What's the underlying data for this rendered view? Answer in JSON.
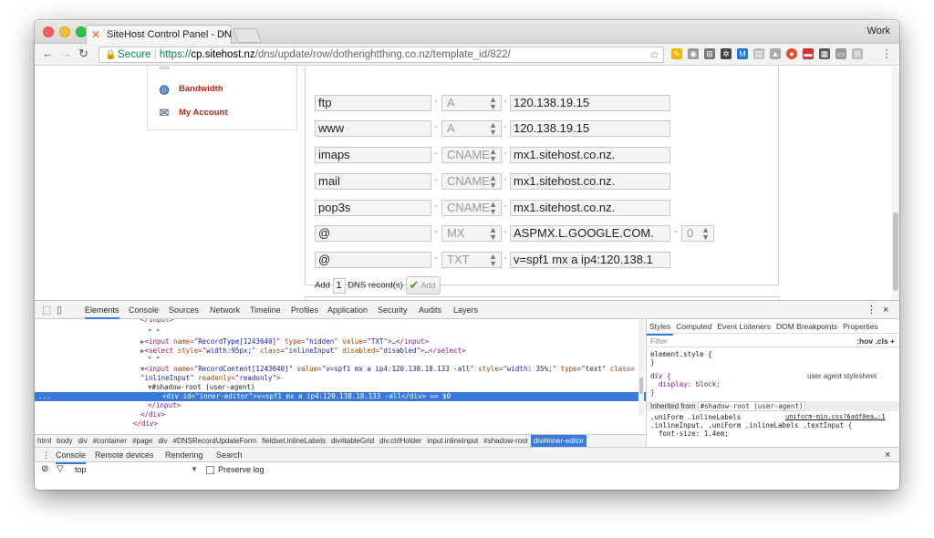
{
  "browser": {
    "tab_title": "SiteHost Control Panel - DNS",
    "tab_close": "×",
    "profile": "Work",
    "url_secure": "Secure",
    "url_scheme": "https://",
    "url_domain": "cp.sitehost.nz",
    "url_path": "/dns/update/row/dotherightthing.co.nz/template_id/822/"
  },
  "sidebar": {
    "items": [
      {
        "label": "Bandwidth",
        "icon": "globe-icon"
      },
      {
        "label": "My Account",
        "icon": "account-icon"
      }
    ]
  },
  "dns": {
    "records": [
      {
        "name": "ftp",
        "type": "A",
        "content": "120.138.19.15",
        "disabled": false
      },
      {
        "name": "www",
        "type": "A",
        "content": "120.138.19.15",
        "disabled": false
      },
      {
        "name": "imaps",
        "type": "CNAME",
        "content": "mx1.sitehost.co.nz.",
        "disabled": true
      },
      {
        "name": "mail",
        "type": "CNAME",
        "content": "mx1.sitehost.co.nz.",
        "disabled": true
      },
      {
        "name": "pop3s",
        "type": "CNAME",
        "content": "mx1.sitehost.co.nz.",
        "disabled": true
      },
      {
        "name": "@",
        "type": "MX",
        "content": "ASPMX.L.GOOGLE.COM.",
        "priority": "0",
        "disabled": true
      },
      {
        "name": "@",
        "type": "TXT",
        "content": "v=spf1 mx a ip4:120.138.1",
        "disabled": true
      }
    ],
    "add_prefix": "Add",
    "add_count": "1",
    "add_suffix": "DNS record(s)",
    "add_button": "Add"
  },
  "devtools": {
    "tabs": [
      "Elements",
      "Console",
      "Sources",
      "Network",
      "Timeline",
      "Profiles",
      "Application",
      "Security",
      "Audits",
      "Layers"
    ],
    "active_tab": "Elements",
    "element_lines": [
      {
        "indent": 116,
        "segments": [
          [
            "t",
            "</input>"
          ]
        ],
        "partial": true
      },
      {
        "indent": 124,
        "segments": [
          [
            "tx",
            "\" \""
          ]
        ]
      },
      {
        "indent": 116,
        "segments": [
          [
            "tri",
            "▶"
          ],
          [
            "t",
            "<input "
          ],
          [
            "an",
            "name"
          ],
          [
            "t",
            "=\""
          ],
          [
            "av",
            "RecordType[1243640]"
          ],
          [
            "t",
            "\" "
          ],
          [
            "an",
            "type"
          ],
          [
            "t",
            "=\""
          ],
          [
            "av",
            "hidden"
          ],
          [
            "t",
            "\" "
          ],
          [
            "an",
            "value"
          ],
          [
            "t",
            "=\""
          ],
          [
            "av",
            "TXT"
          ],
          [
            "t",
            "\">…</input>"
          ]
        ]
      },
      {
        "indent": 116,
        "segments": [
          [
            "tri",
            "▶"
          ],
          [
            "t",
            "<select "
          ],
          [
            "an",
            "style"
          ],
          [
            "t",
            "=\""
          ],
          [
            "av",
            "width:95px;"
          ],
          [
            "t",
            "\" "
          ],
          [
            "an",
            "class"
          ],
          [
            "t",
            "=\""
          ],
          [
            "av",
            "inlineInput"
          ],
          [
            "t",
            "\" "
          ],
          [
            "an",
            "disabled"
          ],
          [
            "t",
            "=\""
          ],
          [
            "av",
            "disabled"
          ],
          [
            "t",
            "\">…</select>"
          ]
        ]
      },
      {
        "indent": 124,
        "segments": [
          [
            "tx",
            "\" \""
          ]
        ]
      },
      {
        "indent": 116,
        "segments": [
          [
            "tri",
            "▼"
          ],
          [
            "t",
            "<input "
          ],
          [
            "an",
            "name"
          ],
          [
            "t",
            "=\""
          ],
          [
            "av",
            "RecordContent[1243640]"
          ],
          [
            "t",
            "\" "
          ],
          [
            "an",
            "value"
          ],
          [
            "t",
            "=\""
          ],
          [
            "av",
            "v=spf1 mx a ip4:120.138.18.133 -all"
          ],
          [
            "t",
            "\" "
          ],
          [
            "an",
            "style"
          ],
          [
            "t",
            "=\""
          ],
          [
            "av",
            "width: 35%;"
          ],
          [
            "t",
            "\" "
          ],
          [
            "an",
            "type"
          ],
          [
            "t",
            "=\""
          ],
          [
            "av",
            "text"
          ],
          [
            "t",
            "\" "
          ],
          [
            "an",
            "class"
          ],
          [
            "t",
            "="
          ]
        ]
      },
      {
        "indent": 116,
        "segments": [
          [
            "t",
            "\""
          ],
          [
            "av",
            "inlineInput"
          ],
          [
            "t",
            "\" "
          ],
          [
            "an",
            "readonly"
          ],
          [
            "t",
            "=\""
          ],
          [
            "av",
            "readonly"
          ],
          [
            "t",
            "\">"
          ]
        ]
      },
      {
        "indent": 124,
        "segments": [
          [
            "tri",
            "▼"
          ],
          [
            "tx",
            "#shadow-root (user-agent)"
          ]
        ]
      },
      {
        "indent": 140,
        "segments": [
          [
            "t",
            "<div "
          ],
          [
            "an",
            "id"
          ],
          [
            "t",
            "=\""
          ],
          [
            "av",
            "inner-editor"
          ],
          [
            "t",
            "\">"
          ],
          [
            "tx",
            "v=spf1 mx a ip4:120.138.18.133 -all"
          ],
          [
            "t",
            "</div>"
          ],
          [
            "tx",
            " == $0"
          ]
        ],
        "selected": true
      },
      {
        "indent": 124,
        "segments": [
          [
            "t",
            "</input>"
          ]
        ]
      },
      {
        "indent": 116,
        "segments": [
          [
            "t",
            "</div>"
          ]
        ]
      },
      {
        "indent": 108,
        "segments": [
          [
            "t",
            "</div>"
          ]
        ],
        "partial": true
      }
    ],
    "ellipsis": "...",
    "breadcrumbs": [
      "html",
      "body",
      "div",
      "#container",
      "#page",
      "div",
      "#DNSRecordUpdateForm",
      "fieldset.inlineLabels",
      "div#tableGrid",
      "div.ctrlHolder",
      "input.inlineInput",
      "#shadow-root",
      "div#inner-editor"
    ],
    "styles_tabs": [
      "Styles",
      "Computed",
      "Event Listeners",
      "DOM Breakpoints",
      "Properties"
    ],
    "filter_placeholder": "Filter",
    "filter_toggles": ":hov  .cls  +",
    "style_rules": {
      "element_style": "element.style {\n}",
      "div_rule": "div {\n  display: block;\n}",
      "ua_label": "user agent stylesheet",
      "inherited_label": "Inherited from",
      "inherited_from": "#shadow-root (user-agent)",
      "uniform_selector": ".uniForm .inlineLabels\n.inlineInput, .uniForm .inlineLabels .textInput {\n  font-size: 1.4em;",
      "uniform_source": "uniform-min.css?6adf0ea…:1"
    },
    "console_tabs": [
      "Console",
      "Remote devices",
      "Rendering",
      "Search"
    ],
    "console_context": "top",
    "preserve_log": "Preserve log",
    "close": "×",
    "more": "⋮"
  }
}
